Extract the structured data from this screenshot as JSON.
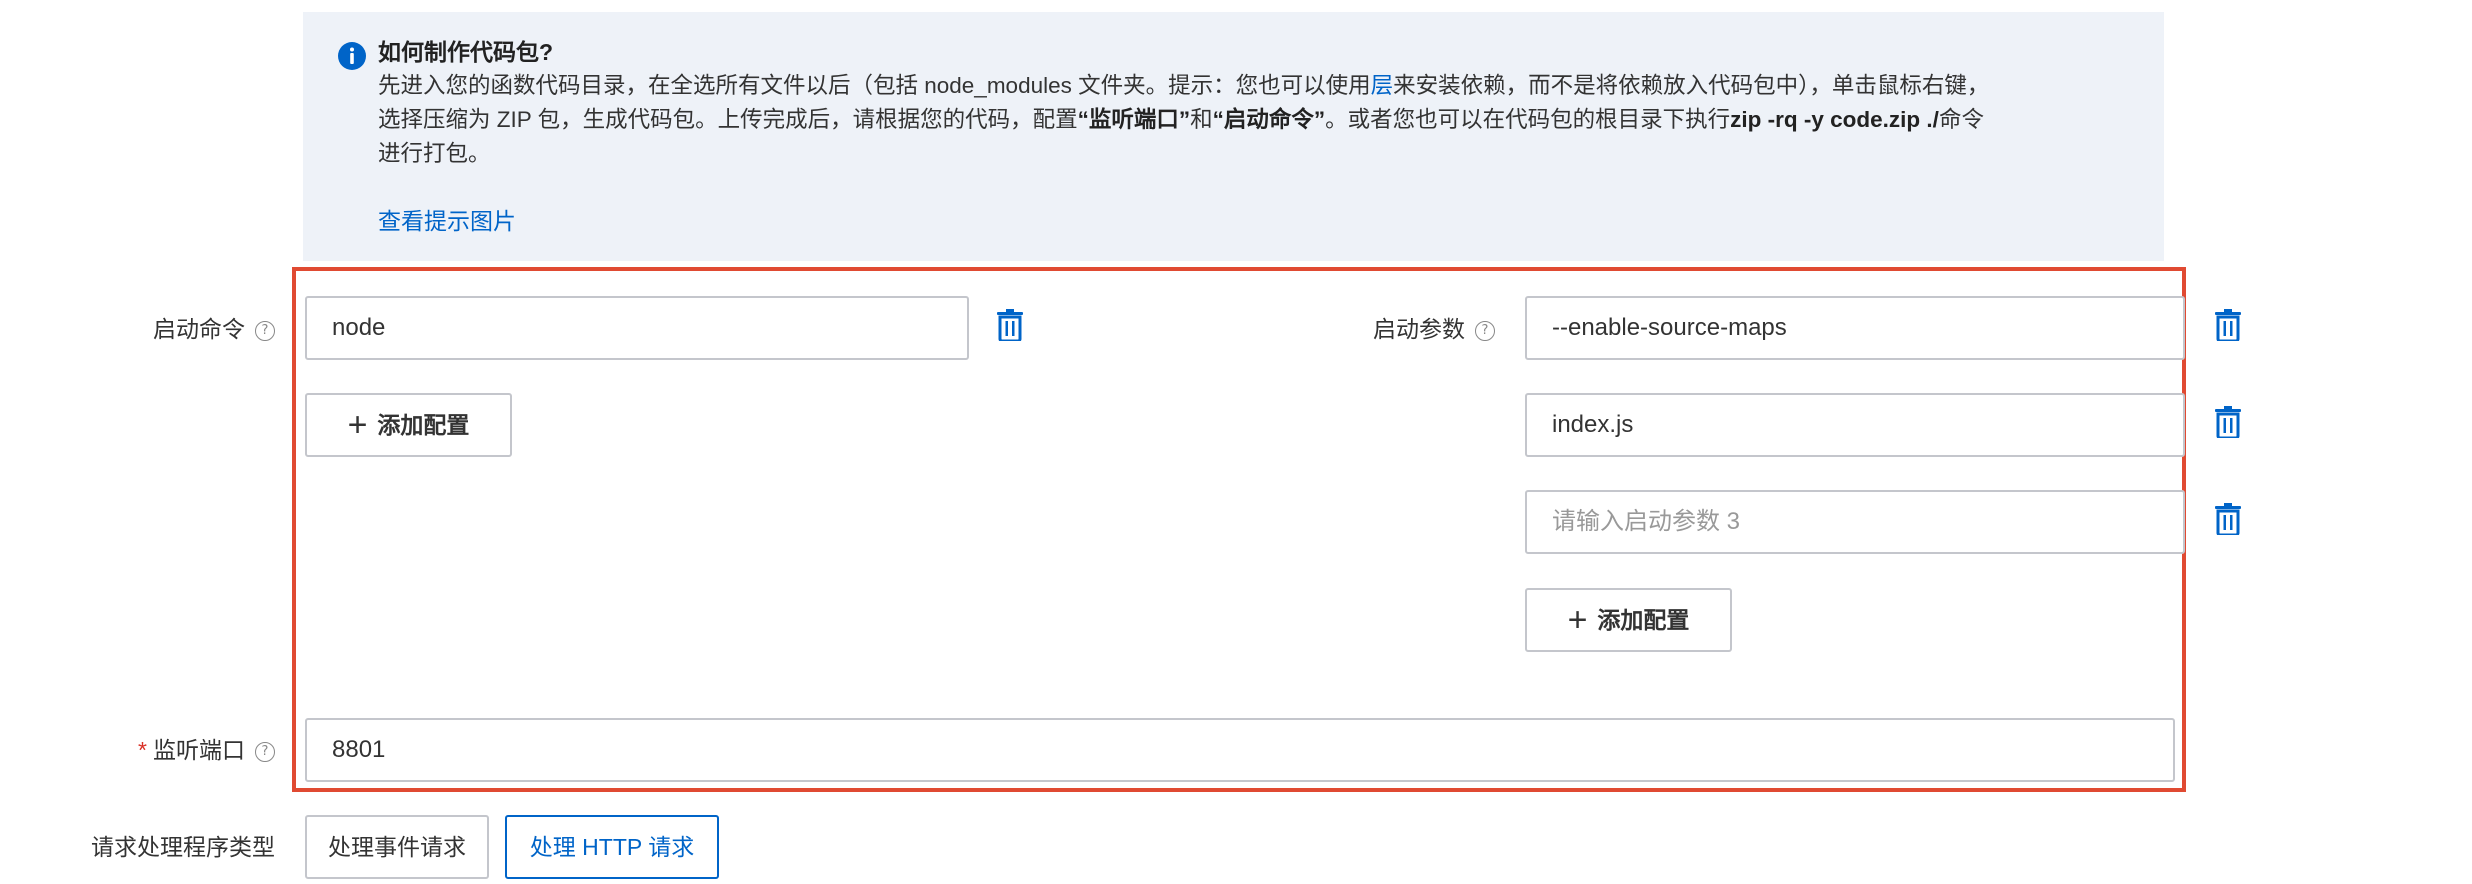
{
  "info": {
    "title": "如何制作代码包?",
    "line1_pre": "先进入您的函数代码目录，在全选所有文件以后（包括 node_modules 文件夹。提示：您也可以使用",
    "line1_link": "层",
    "line1_post": "来安装依赖，而不是将依赖放入代码包中），单击鼠标右键，",
    "line2_pre": "选择压缩为 ZIP 包，生成代码包。上传完成后，请根据您的代码，配置",
    "line2_b1": "“监听端口”",
    "line2_mid": "和",
    "line2_b2": "“启动命令”",
    "line2_post": "。或者您也可以在代码包的根目录下执行",
    "line2_cmd": "zip -rq -y code.zip ./",
    "line2_end": "命令",
    "line3": "进行打包。",
    "view_image_link": "查看提示图片"
  },
  "startup_command": {
    "label": "启动命令",
    "value": "node",
    "add_button": "添加配置"
  },
  "startup_params": {
    "label": "启动参数",
    "values": [
      "--enable-source-maps",
      "index.js"
    ],
    "placeholder": "请输入启动参数 3",
    "add_button": "添加配置"
  },
  "listen_port": {
    "required_mark": "*",
    "label": "监听端口",
    "value": "8801"
  },
  "handler_type": {
    "label": "请求处理程序类型",
    "options": [
      "处理事件请求",
      "处理 HTTP 请求"
    ],
    "selected": "处理 HTTP 请求"
  },
  "colors": {
    "accent": "#0064c8",
    "highlight_frame": "#e04a32",
    "required": "#d93026",
    "info_bg": "#eef2f8"
  }
}
